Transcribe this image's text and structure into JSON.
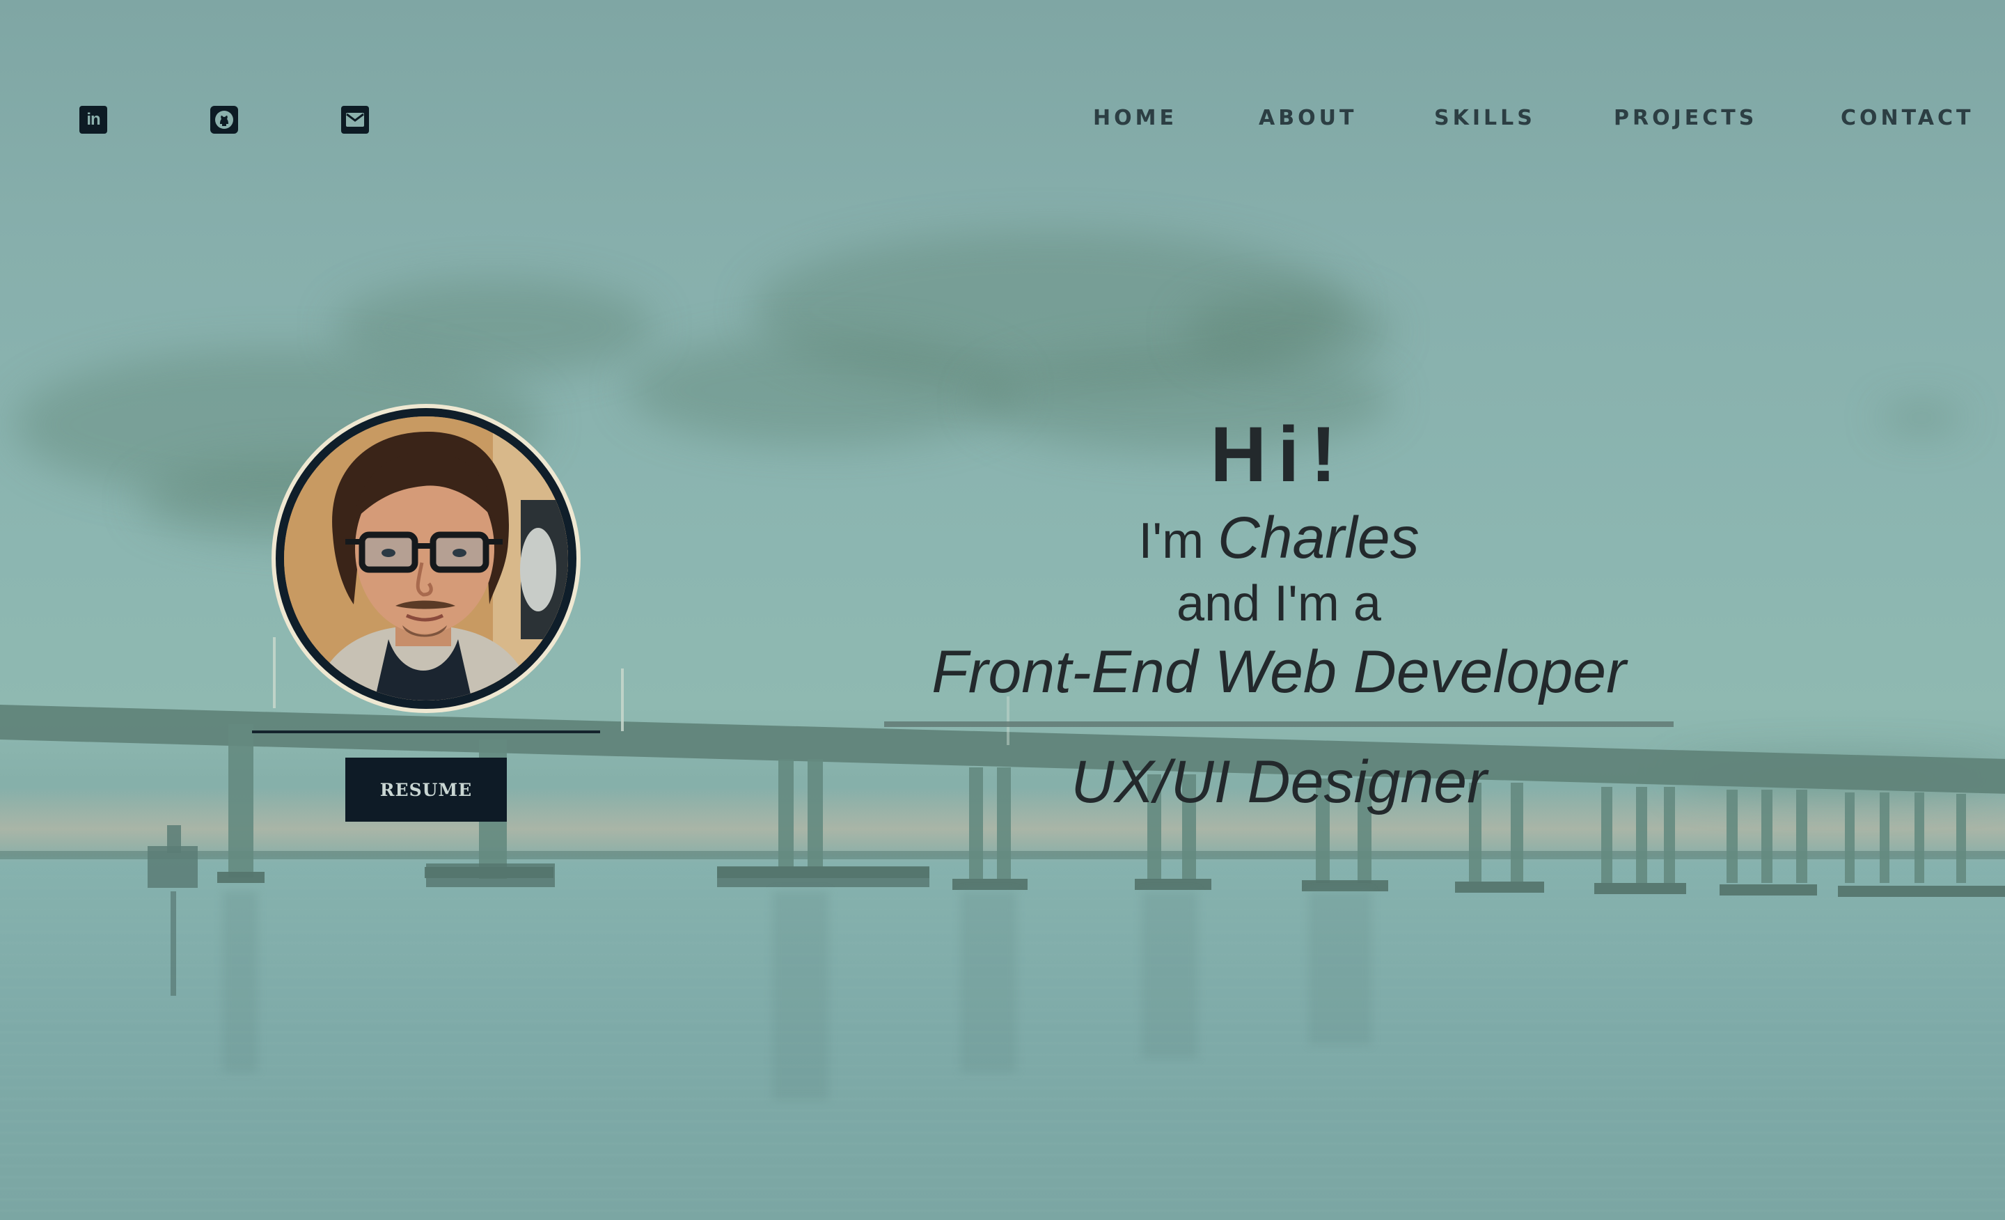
{
  "social": {
    "linkedin_icon": "linkedin-icon",
    "github_icon": "github-icon",
    "email_icon": "envelope-icon"
  },
  "nav": {
    "home": "HOME",
    "about": "ABOUT",
    "skills": "SKILLS",
    "projects": "PROJECTS",
    "contact": "CONTACT"
  },
  "profile": {
    "resume_label": "RESUME"
  },
  "hero": {
    "greeting": "Hi!",
    "intro_prefix": "I'm",
    "name": "Charles",
    "and_line": "and I'm a",
    "role_primary": "Front-End Web Developer",
    "role_secondary": "UX/UI Designer"
  },
  "colors": {
    "accent_dark": "#0e1b26",
    "text": "#23292c",
    "background": "#87afac"
  }
}
